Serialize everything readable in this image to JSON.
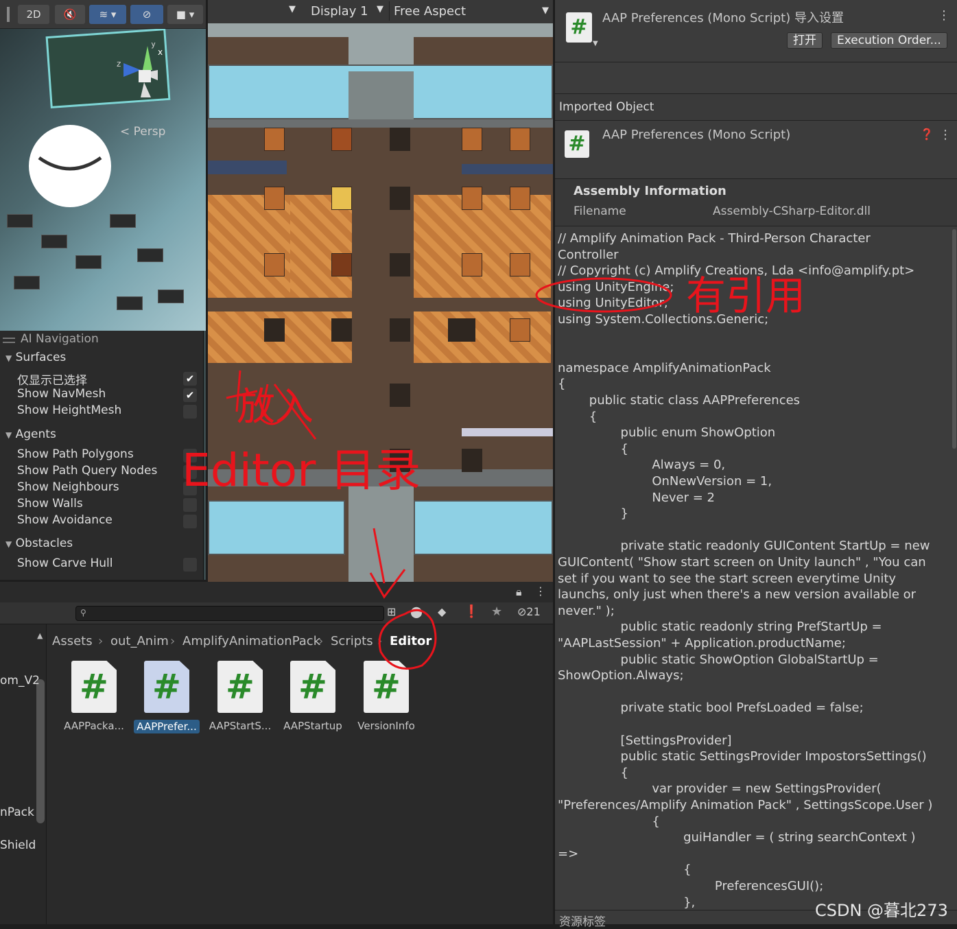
{
  "scene_toolbar": {
    "btn_2d": "2D",
    "persp_label": "< Persp"
  },
  "nav_overlay": {
    "title": "AI Navigation",
    "surfaces": "Surfaces",
    "show_selected_only": "仅显示已选择",
    "show_navmesh": "Show NavMesh",
    "show_heightmesh": "Show HeightMesh",
    "agents": "Agents",
    "show_path_polygons": "Show Path Polygons",
    "show_path_query_nodes": "Show Path Query Nodes",
    "show_neighbours": "Show Neighbours",
    "show_walls": "Show Walls",
    "show_avoidance": "Show Avoidance",
    "obstacles": "Obstacles",
    "show_carve_hull": "Show Carve Hull"
  },
  "game_toolbar": {
    "display": "Display 1",
    "aspect": "Free Aspect"
  },
  "inspector": {
    "title": "AAP Preferences (Mono Script) 导入设置",
    "open_btn": "打开",
    "exec_order_btn": "Execution Order...",
    "imported_object": "Imported Object",
    "sub_title": "AAP Preferences (Mono Script)",
    "assembly_info": "Assembly Information",
    "filename_label": "Filename",
    "filename_value": "Assembly-CSharp-Editor.dll",
    "code_lines": [
      "// Amplify Animation Pack - Third-Person Character",
      "Controller",
      "// Copyright (c) Amplify Creations, Lda <info@amplify.pt>",
      "using UnityEngine;",
      "using UnityEditor;",
      "using System.Collections.Generic;",
      "",
      "",
      "namespace AmplifyAnimationPack",
      "{",
      "        public static class AAPPreferences",
      "        {",
      "                public enum ShowOption",
      "                {",
      "                        Always = 0,",
      "                        OnNewVersion = 1,",
      "                        Never = 2",
      "                }",
      "",
      "                private static readonly GUIContent StartUp = new",
      "GUIContent( \"Show start screen on Unity launch\" , \"You can",
      "set if you want to see the start screen everytime Unity",
      "launchs, only just when there's a new version available or",
      "never.\" );",
      "                public static readonly string PrefStartUp =",
      "\"AAPLastSession\" + Application.productName;",
      "                public static ShowOption GlobalStartUp =",
      "ShowOption.Always;",
      "",
      "                private static bool PrefsLoaded = false;",
      "",
      "                [SettingsProvider]",
      "                public static SettingsProvider ImpostorsSettings()",
      "                {",
      "                        var provider = new SettingsProvider(",
      "\"Preferences/Amplify Animation Pack\" , SettingsScope.User )",
      "                        {",
      "                                guiHandler = ( string searchContext )",
      "=>",
      "                                {",
      "                                        PreferencesGUI();",
      "                                },"
    ],
    "bottom_label": "资源标签"
  },
  "project": {
    "hidden_count": "21",
    "breadcrumb": [
      "Assets",
      "out_Anim",
      "AmplifyAnimationPack",
      "Scripts",
      "Editor"
    ],
    "left_items": [
      "om_V2",
      "nPack",
      "Shield"
    ],
    "files": [
      {
        "name": "AAPPacka...",
        "selected": false
      },
      {
        "name": "AAPPrefer...",
        "selected": true
      },
      {
        "name": "AAPStartS...",
        "selected": false
      },
      {
        "name": "AAPStartup",
        "selected": false
      },
      {
        "name": "VersionInfo",
        "selected": false
      }
    ]
  },
  "annotations": {
    "has_reference": "有引用",
    "put_into": "放入",
    "editor_dir": "Editor 目录"
  },
  "watermark": "CSDN @暮北273"
}
